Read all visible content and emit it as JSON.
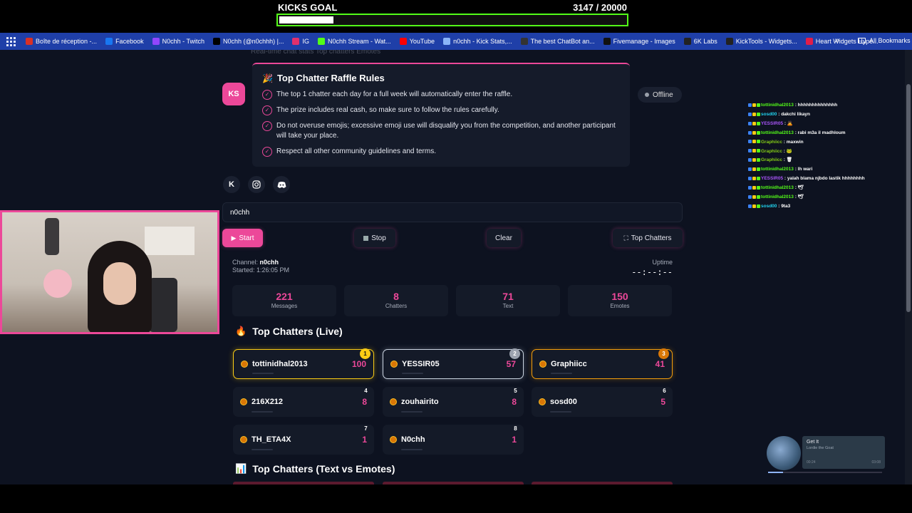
{
  "goal": {
    "title": "KICKS GOAL",
    "count": "3147  / 20000",
    "progress": 0.157
  },
  "bookmarks": {
    "items": [
      {
        "label": "Boîte de réception -...",
        "icon": "mail-icon",
        "color": "#d93025"
      },
      {
        "label": "Facebook",
        "icon": "facebook-icon",
        "color": "#1877f2"
      },
      {
        "label": "N0chh - Twitch",
        "icon": "twitch-icon",
        "color": "#9146ff"
      },
      {
        "label": "N0chh (@n0chhh) |...",
        "icon": "tiktok-icon",
        "color": "#000000"
      },
      {
        "label": "IG",
        "icon": "instagram-icon",
        "color": "#e1306c"
      },
      {
        "label": "N0chh Stream - Wat...",
        "icon": "kick-icon",
        "color": "#53fc18"
      },
      {
        "label": "YouTube",
        "icon": "youtube-icon",
        "color": "#ff0000"
      },
      {
        "label": "n0chh - Kick Stats,...",
        "icon": "link-icon",
        "color": "#8ab4f8"
      },
      {
        "label": "The best ChatBot an...",
        "icon": "bot-icon",
        "color": "#333333"
      },
      {
        "label": "Fivemanage - Images",
        "icon": "fivemanage-icon",
        "color": "#111111"
      },
      {
        "label": "6K Labs",
        "icon": "labs-icon",
        "color": "#222222"
      },
      {
        "label": "KickTools - Widgets...",
        "icon": "grid-icon",
        "color": "#222222"
      },
      {
        "label": "Heart Widgets Hype...",
        "icon": "heart-icon",
        "color": "#e11d48"
      }
    ],
    "more": "»",
    "all_bookmarks": "All Bookmarks"
  },
  "page": {
    "ghost_tabs": "Real-time chat stats   Top chatters   Emotes",
    "avatar_initials": "KS",
    "status": "Offline",
    "rules": {
      "title": "Top Chatter Raffle Rules",
      "items": [
        "The top 1 chatter each day for a full week will automatically enter the raffle.",
        "The prize includes real cash, so make sure to follow the rules carefully.",
        "Do not overuse emojis; excessive emoji use will disqualify you from the competition, and another participant will take your place.",
        "Respect all other community guidelines and terms."
      ]
    },
    "social": {
      "kick": "K"
    },
    "channel_input": "n0chh",
    "buttons": {
      "start": "Start",
      "stop": "Stop",
      "clear": "Clear",
      "top_chatters": "Top Chatters"
    },
    "meta": {
      "channel_label": "Channel:",
      "channel": "n0chh",
      "started": "Started: 1:26:05 PM",
      "uptime_label": "Uptime",
      "uptime": "--:--:--"
    },
    "stats": [
      {
        "value": "221",
        "label": "Messages"
      },
      {
        "value": "8",
        "label": "Chatters"
      },
      {
        "value": "71",
        "label": "Text"
      },
      {
        "value": "150",
        "label": "Emotes"
      }
    ],
    "live_title": "Top Chatters (Live)",
    "chatters": [
      {
        "rank": "1",
        "name": "tottinidhal2013",
        "count": "100"
      },
      {
        "rank": "2",
        "name": "YESSIR05",
        "count": "57"
      },
      {
        "rank": "3",
        "name": "Graphiicc",
        "count": "41"
      },
      {
        "rank": "4",
        "name": "216X212",
        "count": "8"
      },
      {
        "rank": "5",
        "name": "zouhairito",
        "count": "8"
      },
      {
        "rank": "6",
        "name": "sosd00",
        "count": "5"
      },
      {
        "rank": "7",
        "name": "TH_ETA4X",
        "count": "1"
      },
      {
        "rank": "8",
        "name": "N0chh",
        "count": "1"
      }
    ],
    "text_vs_emotes_title": "Top Chatters (Text vs Emotes)"
  },
  "chat": [
    {
      "user": "tottinidhal2013",
      "msg": ": hhhhhhhhhhhhhh",
      "color": "#53fc18"
    },
    {
      "user": "sosd00",
      "msg": ": dakchi likayn",
      "color": "#22d3ee"
    },
    {
      "user": "YESSIR05",
      "msg": ": 🙇",
      "color": "#a855f7"
    },
    {
      "user": "tottinidhal2013",
      "msg": ": rabi m3a il madhloum",
      "color": "#53fc18"
    },
    {
      "user": "Graphiicc",
      "msg": ": maxwin",
      "color": "#84cc16"
    },
    {
      "user": "Graphiicc",
      "msg": ": 🐸",
      "color": "#84cc16"
    },
    {
      "user": "Graphiicc",
      "msg": ": 🗑",
      "color": "#84cc16"
    },
    {
      "user": "tottinidhal2013",
      "msg": ": lh wari",
      "color": "#53fc18"
    },
    {
      "user": "YESSIR05",
      "msg": ": yalah blama njbdo lastik hhhhhhhh",
      "color": "#a855f7"
    },
    {
      "user": "tottinidhal2013",
      "msg": ": 🕊",
      "color": "#53fc18"
    },
    {
      "user": "tottinidhal2013",
      "msg": ": 🕊",
      "color": "#53fc18"
    },
    {
      "user": "sosd00",
      "msg": ": 9ta3",
      "color": "#22d3ee"
    }
  ],
  "music": {
    "song": "Get It",
    "artist": "Lordie the Goat",
    "elapsed": "00:24",
    "duration": "03:08",
    "progress": 0.13
  }
}
